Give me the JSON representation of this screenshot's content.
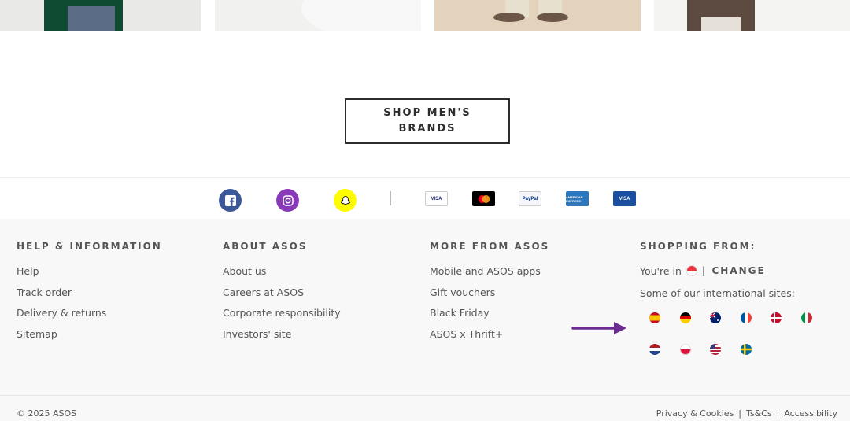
{
  "cta": {
    "label": "SHOP MEN'S BRANDS"
  },
  "social": [
    {
      "name": "facebook-icon",
      "color": "#3b5998"
    },
    {
      "name": "instagram-icon",
      "color": "#8a3ab9"
    },
    {
      "name": "snapchat-icon",
      "color": "#fffc00"
    }
  ],
  "payments": [
    {
      "name": "visa-icon",
      "label": "VISA"
    },
    {
      "name": "mastercard-icon",
      "label": "mastercard"
    },
    {
      "name": "paypal-icon",
      "label": "PayPal"
    },
    {
      "name": "amex-icon",
      "label": "AMERICAN EXPRESS"
    },
    {
      "name": "visa-electron-icon",
      "label": "VISA"
    }
  ],
  "footer": {
    "help": {
      "heading": "HELP & INFORMATION",
      "links": [
        "Help",
        "Track order",
        "Delivery & returns",
        "Sitemap"
      ]
    },
    "about": {
      "heading": "ABOUT ASOS",
      "links": [
        "About us",
        "Careers at ASOS",
        "Corporate responsibility",
        "Investors' site"
      ]
    },
    "more": {
      "heading": "MORE FROM ASOS",
      "links": [
        "Mobile and ASOS apps",
        "Gift vouchers",
        "Black Friday",
        "ASOS x Thrift+"
      ]
    },
    "shopping": {
      "heading": "SHOPPING FROM:",
      "youre_in": "You're in",
      "change": "| CHANGE",
      "intl_label": "Some of our international sites:",
      "flags": [
        "spain-flag-icon",
        "germany-flag-icon",
        "australia-flag-icon",
        "france-flag-icon",
        "denmark-flag-icon",
        "italy-flag-icon",
        "netherlands-flag-icon",
        "poland-flag-icon",
        "usa-flag-icon",
        "sweden-flag-icon"
      ]
    }
  },
  "bottom": {
    "copyright": "© 2025 ASOS",
    "privacy": "Privacy & Cookies",
    "terms": "Ts&Cs",
    "accessibility": "Accessibility",
    "separator": "|"
  },
  "colors": {
    "text": "#2d2d2d",
    "footer_bg": "#f8f8f8",
    "arrow": "#6b2c91"
  }
}
